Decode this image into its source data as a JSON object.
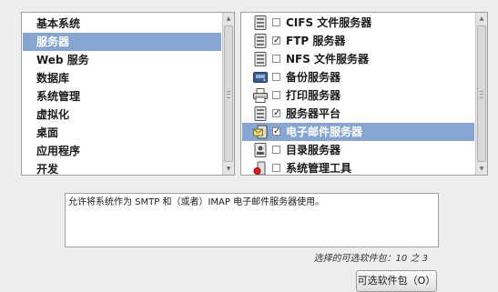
{
  "categories": [
    {
      "label": "基本系统",
      "selected": false
    },
    {
      "label": "服务器",
      "selected": true
    },
    {
      "label": "Web 服务",
      "selected": false
    },
    {
      "label": "数据库",
      "selected": false
    },
    {
      "label": "系统管理",
      "selected": false
    },
    {
      "label": "虚拟化",
      "selected": false
    },
    {
      "label": "桌面",
      "selected": false
    },
    {
      "label": "应用程序",
      "selected": false
    },
    {
      "label": "开发",
      "selected": false
    }
  ],
  "packages": [
    {
      "label": "CIFS 文件服务器",
      "checked": false,
      "selected": false,
      "icon": "server-icon",
      "check_mark": ""
    },
    {
      "label": "FTP 服务器",
      "checked": true,
      "selected": false,
      "icon": "server-icon",
      "check_mark": "✓"
    },
    {
      "label": "NFS 文件服务器",
      "checked": false,
      "selected": false,
      "icon": "server-icon",
      "check_mark": ""
    },
    {
      "label": "备份服务器",
      "checked": false,
      "selected": false,
      "icon": "backup-drive-icon",
      "check_mark": ""
    },
    {
      "label": "打印服务器",
      "checked": false,
      "selected": false,
      "icon": "printer-icon",
      "check_mark": ""
    },
    {
      "label": "服务器平台",
      "checked": true,
      "selected": false,
      "icon": "server-icon",
      "check_mark": "✓"
    },
    {
      "label": "电子邮件服务器",
      "checked": true,
      "selected": true,
      "icon": "mail-server-icon",
      "check_mark": "✓"
    },
    {
      "label": "目录服务器",
      "checked": false,
      "selected": false,
      "icon": "directory-server-icon",
      "check_mark": ""
    },
    {
      "label": "系统管理工具",
      "checked": false,
      "selected": false,
      "icon": "admin-tools-icon",
      "check_mark": ""
    }
  ],
  "description": "允许将系统作为 SMTP 和（或者）IMAP 电子邮件服务器使用。",
  "status": "选择的可选软件包：10 之 3",
  "optional_button_label": "可选软件包（O）",
  "colors": {
    "selection": "#86a5d1",
    "background": "#ededed"
  }
}
